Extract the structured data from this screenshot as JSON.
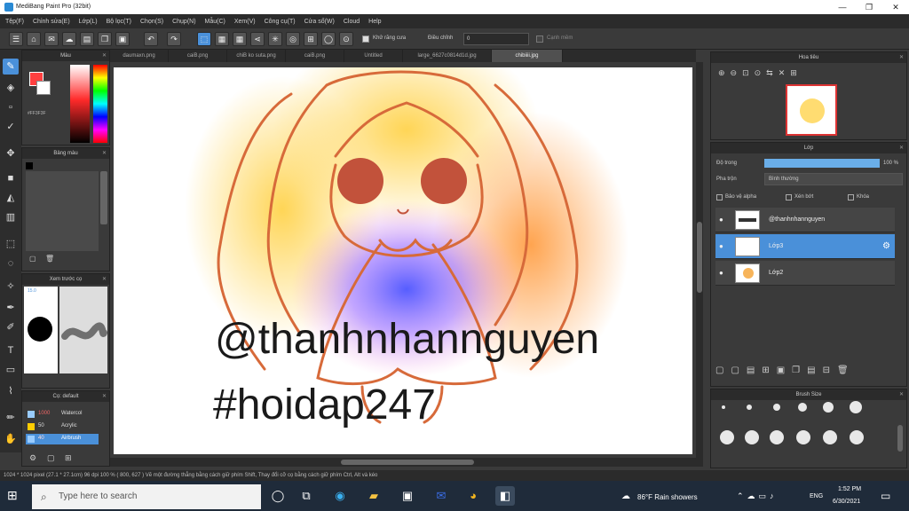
{
  "titlebar": {
    "title": "MediBang Paint Pro (32bit)"
  },
  "menu": [
    "Tệp(F)",
    "Chỉnh sửa(E)",
    "Lớp(L)",
    "Bộ lọc(T)",
    "Chọn(S)",
    "Chụp(N)",
    "Mẫu(C)",
    "Xem(V)",
    "Công cụ(T)",
    "Cửa sổ(W)",
    "Cloud",
    "Help"
  ],
  "toolbar": {
    "cb_label": "Khử răng cưa",
    "adjust_label": "Điều chỉnh",
    "adjust_value": "0",
    "edge_label": "Cạnh mềm"
  },
  "tabs": [
    "daumaxn.png",
    "caiB.png",
    "chiB ko suta.png",
    "caiB.png",
    "Untitled",
    "large_6627c0814d1d.jpg",
    "chibiiii.jpg"
  ],
  "color_panel": {
    "title": "Màu",
    "hex": "#FF3F3F"
  },
  "palette_panel": {
    "title": "Bảng màu"
  },
  "brush_preview": {
    "title": "Xem trước cọ",
    "size": "15.0"
  },
  "brush_list": {
    "title": "Cọ: default",
    "items": [
      {
        "size": "1000",
        "name": "Watercol"
      },
      {
        "size": "50",
        "name": "Acrylic"
      },
      {
        "size": "40",
        "name": "Airbrush"
      }
    ]
  },
  "navigator": {
    "title": "Hoa tiêu"
  },
  "layer_panel": {
    "title": "Lớp",
    "opacity_label": "Độ trong",
    "opacity_value": "100 %",
    "opacity_fraction": 1.0,
    "blend_label": "Pha trộn",
    "blend_value": "Bình thường",
    "protect_label": "Bảo vệ alpha",
    "clip_label": "Xén bớt",
    "lock_label": "Khóa",
    "layers": [
      {
        "name": "@thanhnhannguyen"
      },
      {
        "name": "Lớp3"
      },
      {
        "name": "Lớp2"
      }
    ]
  },
  "brush_size": {
    "title": "Brush Size"
  },
  "canvas": {
    "text1": "@thanhnhannguyen",
    "text2": "#hoidap247"
  },
  "status": "1024 * 1024 pixel   (27.1 * 27.1cm)   96 dpi   100 %   ( 800, 627 )   Vẽ một đường thẳng bằng cách giữ phím Shift, Thay đổi cỡ cọ bằng cách giữ phím Ctrl, Alt và kéo",
  "taskbar": {
    "search_placeholder": "Type here to search",
    "weather": "86°F  Rain showers",
    "lang": "ENG",
    "time": "1:52 PM",
    "date": "6/30/2021"
  }
}
